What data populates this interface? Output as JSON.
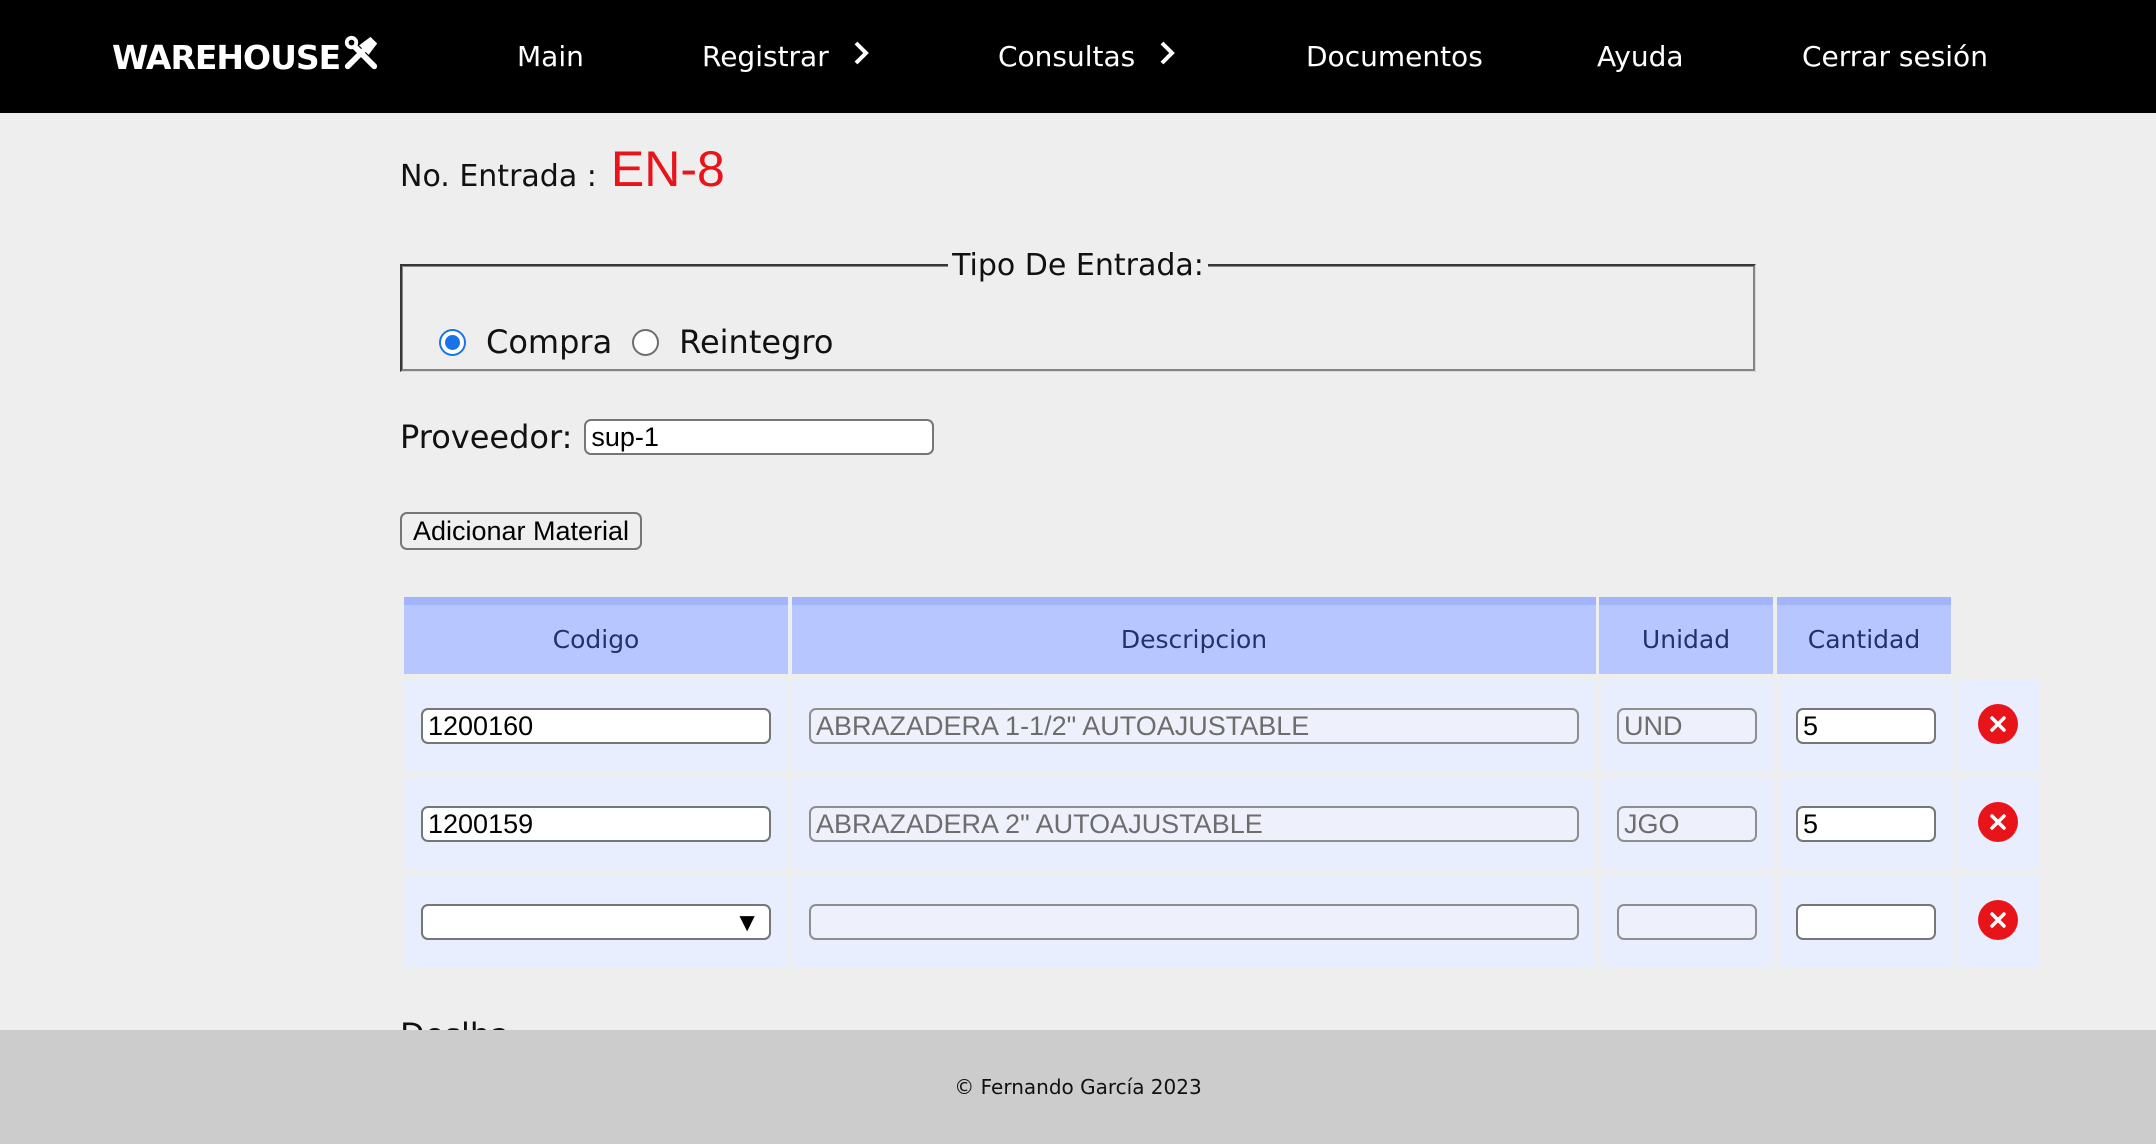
{
  "brand": {
    "name": "WAREHOUSE",
    "icon": "tools-icon"
  },
  "nav": {
    "items": [
      {
        "label": "Main",
        "has_submenu": false
      },
      {
        "label": "Registrar",
        "has_submenu": true
      },
      {
        "label": "Consultas",
        "has_submenu": true
      },
      {
        "label": "Documentos",
        "has_submenu": false
      },
      {
        "label": "Ayuda",
        "has_submenu": false
      },
      {
        "label": "Cerrar sesión",
        "has_submenu": false
      }
    ]
  },
  "entry": {
    "label": "No. Entrada :",
    "value": "EN-8",
    "value_color": "#e8141a"
  },
  "entry_type": {
    "legend": "Tipo De Entrada:",
    "options": [
      {
        "label": "Compra",
        "checked": true
      },
      {
        "label": "Reintegro",
        "checked": false
      }
    ]
  },
  "provider": {
    "label": "Proveedor:",
    "value": "sup-1"
  },
  "add_button": {
    "label": "Adicionar Material"
  },
  "table": {
    "headers": [
      "Codigo",
      "Descripcion",
      "Unidad",
      "Cantidad"
    ],
    "header_color": "#b7c6ff",
    "rows": [
      {
        "code": "1200160",
        "description": "ABRAZADERA 1-1/2\" AUTOAJUSTABLE",
        "unit": "UND",
        "quantity": "5"
      },
      {
        "code": "1200159",
        "description": "ABRAZADERA 2\" AUTOAJUSTABLE",
        "unit": "JGO",
        "quantity": "5"
      },
      {
        "code": "",
        "description": "",
        "unit": "",
        "quantity": "",
        "code_is_select": true
      }
    ],
    "delete_icon": "close-circle-icon",
    "select_arrow": "▼"
  },
  "partial_text": "Deslha",
  "footer": {
    "text": "© Fernando García 2023"
  }
}
